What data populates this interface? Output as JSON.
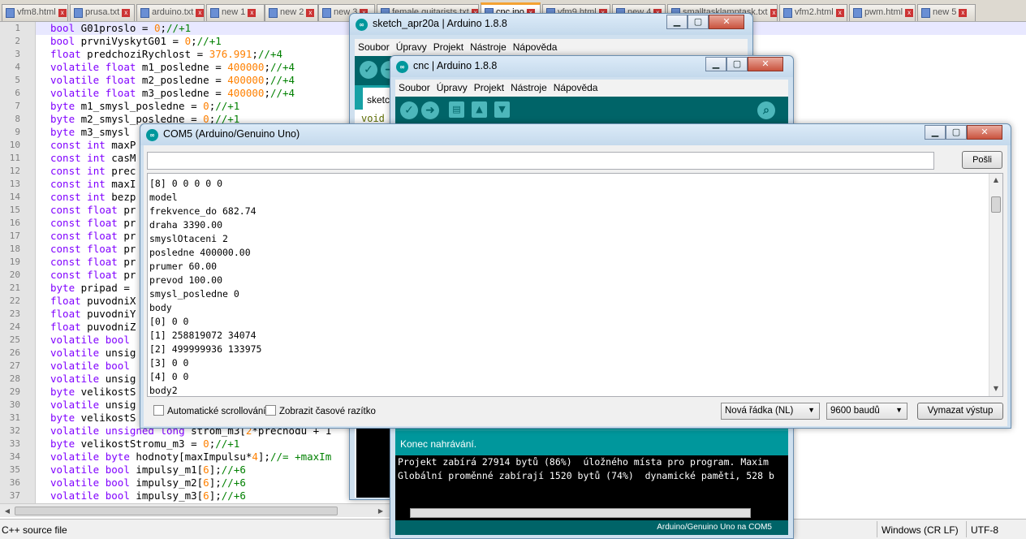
{
  "npp": {
    "tabs": [
      {
        "label": "vfm8.html",
        "active": false
      },
      {
        "label": "prusa.txt",
        "active": false
      },
      {
        "label": "arduino.txt",
        "active": false
      },
      {
        "label": "new 1",
        "active": false
      },
      {
        "label": "new 2",
        "active": false
      },
      {
        "label": "new 3",
        "active": false
      },
      {
        "label": "female guitarists.txt",
        "active": false
      },
      {
        "label": "cnc.ino",
        "active": true
      },
      {
        "label": "vfm9.html",
        "active": false
      },
      {
        "label": "new 4",
        "active": false
      },
      {
        "label": "smalltasklamptask.txt",
        "active": false
      },
      {
        "label": "vfm2.html",
        "active": false
      },
      {
        "label": "pwm.html",
        "active": false
      },
      {
        "label": "new 5",
        "active": false
      }
    ],
    "code_lines": [
      "bool G01proslo = 0;//+1",
      "bool prvniVyskytG01 = 0;//+1",
      "float predchoziRychlost = 376.991;//+4",
      "volatile float m1_posledne = 400000;//+4",
      "volatile float m2_posledne = 400000;//+4",
      "volatile float m3_posledne = 400000;//+4",
      "byte m1_smysl_posledne = 0;//+1",
      "byte m2_smysl_posledne = 0;//+1",
      "byte m3_smysl",
      "const int maxP",
      "const int casM",
      "const int prec",
      "const int maxI",
      "const int bezp",
      "const float pr",
      "const float pr",
      "const float pr",
      "const float pr",
      "const float pr",
      "const float pr",
      "byte pripad =",
      "float puvodniX",
      "float puvodniY",
      "float puvodniZ",
      "volatile bool",
      "volatile unsig",
      "volatile bool",
      "volatile unsig",
      "byte velikostS",
      "volatile unsig",
      "byte velikostS",
      "volatile unsigned long strom_m3[2*prechodu + 1",
      "byte velikostStromu_m3 = 0;//+1",
      "volatile byte hodnoty[maxImpulsu*4];//= +maxIm",
      "volatile bool impulsy_m1[6];//+6",
      "volatile bool impulsy_m2[6];//+6",
      "volatile bool impulsy_m3[6];//+6"
    ],
    "status": {
      "file_type": "C++ source file",
      "eol": "Windows (CR LF)",
      "encoding": "UTF-8"
    }
  },
  "sketch_window": {
    "title": "sketch_apr20a | Arduino 1.8.8",
    "menu": [
      "Soubor",
      "Úpravy",
      "Projekt",
      "Nástroje",
      "Nápověda"
    ],
    "tab_label": "sketc",
    "code_peek": "void"
  },
  "cnc_window": {
    "title": "cnc | Arduino 1.8.8",
    "menu": [
      "Soubor",
      "Úpravy",
      "Projekt",
      "Nástroje",
      "Nápověda"
    ],
    "status_message": "Konec nahrávání.",
    "console_lines": [
      "Projekt zabírá 27914 bytů (86%)  úložného místa pro program. Maxim",
      "Globální proměnné zabírají 1520 bytů (74%)  dynamické paměti, 528 b"
    ],
    "board_info": "Arduino/Genuino Uno na COM5"
  },
  "serial_monitor": {
    "title": "COM5 (Arduino/Genuino Uno)",
    "input_value": "",
    "send_label": "Pošli",
    "output_lines": [
      "[8] 0 0 0 0 0",
      "model",
      "frekvence_do 682.74",
      "draha 3390.00",
      "smyslOtaceni 2",
      "posledne 400000.00",
      "prumer 60.00",
      "prevod 100.00",
      "smysl_posledne 0",
      "body",
      "[0] 0 0",
      "[1] 258819072 34074",
      "[2] 499999936 133975",
      "[3] 0 0",
      "[4] 0 0",
      "body2"
    ],
    "autoscroll_label": "Automatické scrollování",
    "timestamp_label": "Zobrazit časové razítko",
    "line_ending": "Nová řádka (NL)",
    "baud": "9600 baudů",
    "clear_label": "Vymazat výstup"
  },
  "colors": {
    "arduino_teal": "#00979c",
    "arduino_dark": "#006468",
    "npp_keyword": "#8000ff",
    "npp_number": "#ff8000",
    "npp_comment": "#008000"
  }
}
